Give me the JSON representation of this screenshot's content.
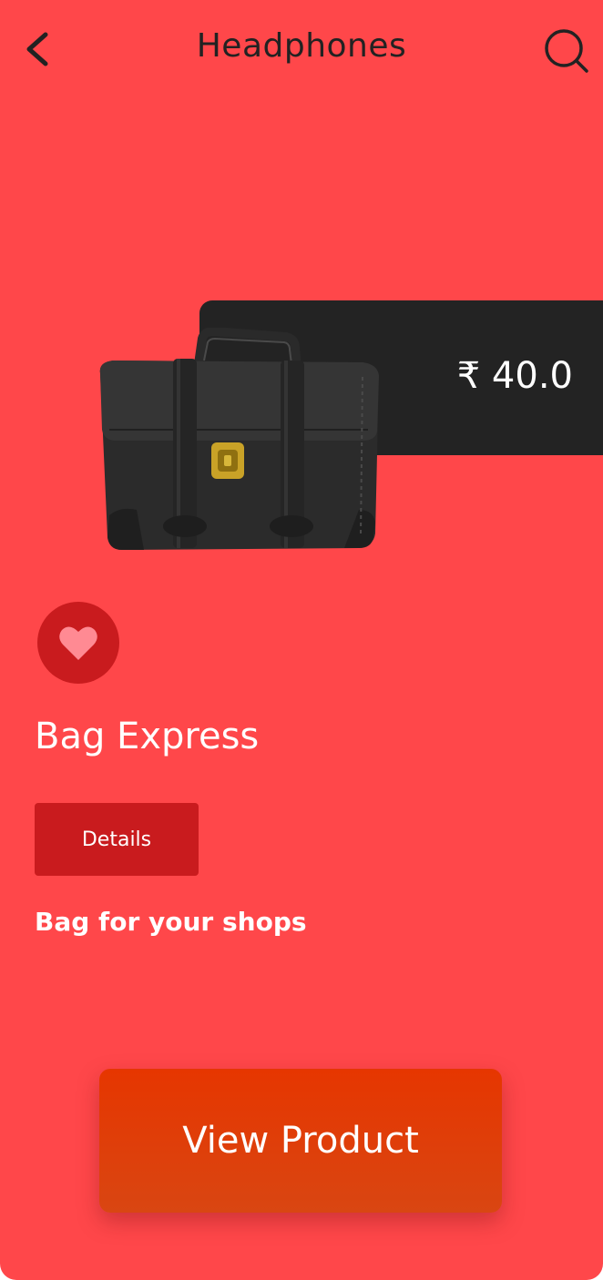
{
  "header": {
    "title": "Headphones",
    "back_icon": "chevron-left-icon",
    "search_icon": "search-icon"
  },
  "product": {
    "price": "₹ 40.0",
    "name": "Bag Express",
    "details_label": "Details",
    "description": "Bag for your shops",
    "favorite_icon": "heart-icon",
    "image": "black-leather-briefcase"
  },
  "actions": {
    "view_product_label": "View Product"
  },
  "colors": {
    "background": "#ff474a",
    "price_card": "#232323",
    "accent_dark_red": "#c91b1e",
    "heart": "#ff8a93",
    "cta": "#e63600"
  }
}
